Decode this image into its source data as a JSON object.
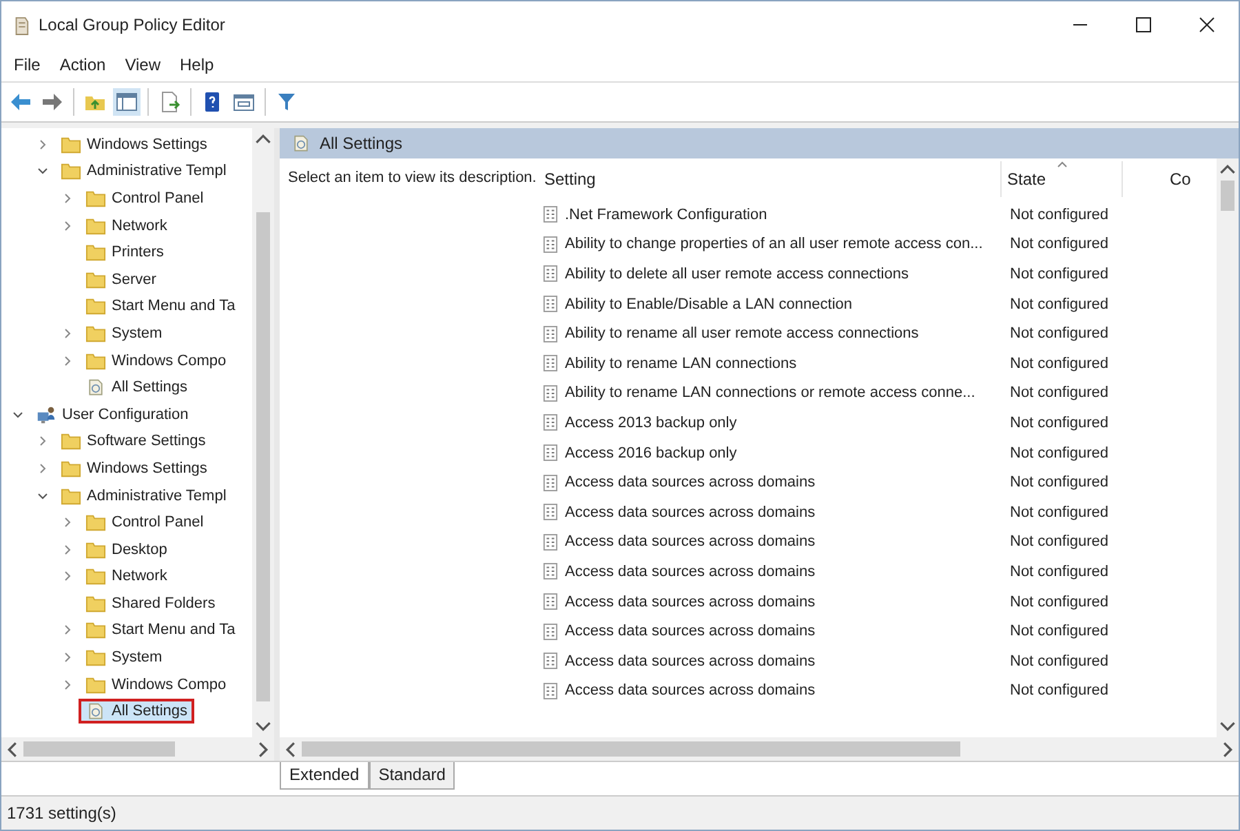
{
  "window": {
    "title": "Local Group Policy Editor"
  },
  "menu": [
    "File",
    "Action",
    "View",
    "Help"
  ],
  "tree": {
    "nodes": [
      {
        "children": [
          {
            "label": "Windows Settings",
            "kind": "folder",
            "expanded": false,
            "selected": false
          },
          {
            "label": "Administrative Templ",
            "kind": "folder",
            "expanded": true,
            "selected": false,
            "children": [
              {
                "label": "Control Panel",
                "kind": "folder",
                "expanded": false,
                "selected": false
              },
              {
                "label": "Network",
                "kind": "folder",
                "expanded": false,
                "selected": false
              },
              {
                "label": "Printers",
                "kind": "folder",
                "selected": false
              },
              {
                "label": "Server",
                "kind": "folder",
                "selected": false
              },
              {
                "label": "Start Menu and Ta",
                "kind": "folder",
                "selected": false
              },
              {
                "label": "System",
                "kind": "folder",
                "expanded": false,
                "selected": false
              },
              {
                "label": "Windows Compo",
                "kind": "folder",
                "expanded": false,
                "selected": false
              },
              {
                "label": "All Settings",
                "kind": "settings",
                "selected": false
              }
            ]
          }
        ]
      },
      {
        "label": "User Configuration",
        "kind": "computer",
        "expanded": true,
        "selected": false,
        "children": [
          {
            "label": "Software Settings",
            "kind": "folder",
            "expanded": false,
            "selected": false
          },
          {
            "label": "Windows Settings",
            "kind": "folder",
            "expanded": false,
            "selected": false
          },
          {
            "label": "Administrative Templ",
            "kind": "folder",
            "expanded": true,
            "selected": false,
            "children": [
              {
                "label": "Control Panel",
                "kind": "folder",
                "expanded": false,
                "selected": false
              },
              {
                "label": "Desktop",
                "kind": "folder",
                "expanded": false,
                "selected": false
              },
              {
                "label": "Network",
                "kind": "folder",
                "expanded": false,
                "selected": false
              },
              {
                "label": "Shared Folders",
                "kind": "folder",
                "selected": false
              },
              {
                "label": "Start Menu and Ta",
                "kind": "folder",
                "expanded": false,
                "selected": false
              },
              {
                "label": "System",
                "kind": "folder",
                "expanded": false,
                "selected": false
              },
              {
                "label": "Windows Compo",
                "kind": "folder",
                "expanded": false,
                "selected": false
              },
              {
                "label": "All Settings",
                "kind": "settings",
                "selected": true
              }
            ]
          }
        ]
      }
    ]
  },
  "details": {
    "title": "All Settings",
    "description": "Select an item to view its description.",
    "columns": [
      "Setting",
      "State",
      "Co"
    ],
    "rows": [
      {
        "setting": ".Net Framework Configuration",
        "state": "Not configured"
      },
      {
        "setting": "Ability to change properties of an all user remote access con...",
        "state": "Not configured"
      },
      {
        "setting": "Ability to delete all user remote access connections",
        "state": "Not configured"
      },
      {
        "setting": "Ability to Enable/Disable a LAN connection",
        "state": "Not configured"
      },
      {
        "setting": "Ability to rename all user remote access connections",
        "state": "Not configured"
      },
      {
        "setting": "Ability to rename LAN connections",
        "state": "Not configured"
      },
      {
        "setting": "Ability to rename LAN connections or remote access conne...",
        "state": "Not configured"
      },
      {
        "setting": "Access 2013 backup only",
        "state": "Not configured"
      },
      {
        "setting": "Access 2016 backup only",
        "state": "Not configured"
      },
      {
        "setting": "Access data sources across domains",
        "state": "Not configured"
      },
      {
        "setting": "Access data sources across domains",
        "state": "Not configured"
      },
      {
        "setting": "Access data sources across domains",
        "state": "Not configured"
      },
      {
        "setting": "Access data sources across domains",
        "state": "Not configured"
      },
      {
        "setting": "Access data sources across domains",
        "state": "Not configured"
      },
      {
        "setting": "Access data sources across domains",
        "state": "Not configured"
      },
      {
        "setting": "Access data sources across domains",
        "state": "Not configured"
      },
      {
        "setting": "Access data sources across domains",
        "state": "Not configured"
      }
    ]
  },
  "tabs": [
    {
      "label": "Extended",
      "selected": true
    },
    {
      "label": "Standard",
      "selected": false
    }
  ],
  "status_bar": "1731 setting(s)"
}
